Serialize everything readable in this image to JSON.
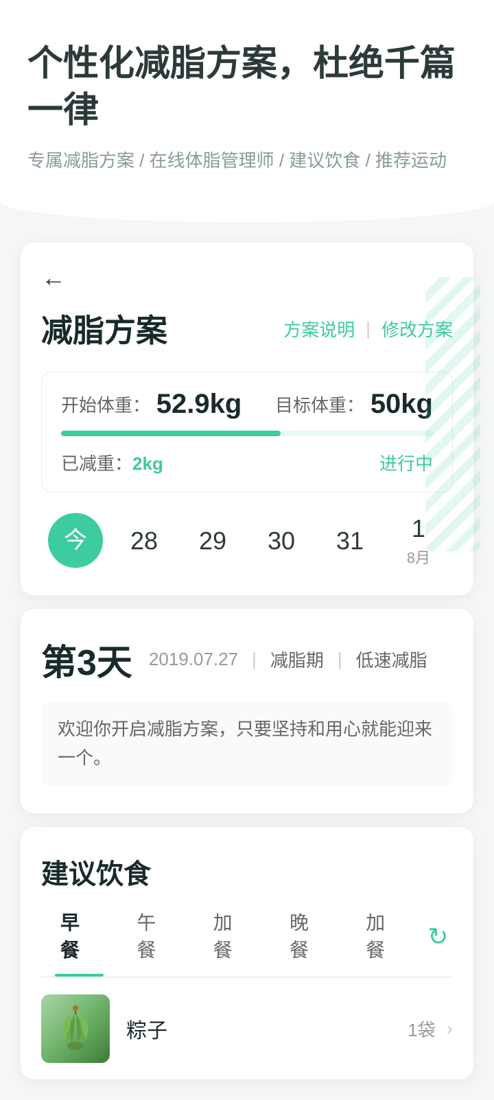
{
  "header": {
    "main_title": "个性化减脂方案，杜绝千篇一律",
    "subtitle": "专属减脂方案 / 在线体脂管理师 / 建议饮食 / 推荐运动"
  },
  "plan_card": {
    "back_label": "←",
    "title": "减脂方案",
    "action_description": "方案说明",
    "action_divider": "|",
    "action_modify": "修改方案",
    "start_label": "开始体重：",
    "start_value": "52.9kg",
    "target_label": "目标体重：",
    "target_value": "50kg",
    "progress_percent": 59,
    "lost_label": "已减重：",
    "lost_value": "2kg",
    "status": "进行中"
  },
  "calendar": {
    "days": [
      {
        "label": "今",
        "sub": "",
        "today": true
      },
      {
        "label": "28",
        "sub": ""
      },
      {
        "label": "29",
        "sub": ""
      },
      {
        "label": "30",
        "sub": ""
      },
      {
        "label": "31",
        "sub": ""
      },
      {
        "label": "1",
        "sub": "8月"
      }
    ]
  },
  "day_info": {
    "day_number": "第3天",
    "date": "2019.07.27",
    "separator1": "|",
    "tag1": "减脂期",
    "separator2": "|",
    "tag2": "低速减脂",
    "welcome_text": "欢迎你开启减脂方案，只要坚持和用心就能迎来一个。"
  },
  "diet_section": {
    "title": "建议饮食",
    "tabs": [
      {
        "label": "早餐",
        "active": true
      },
      {
        "label": "午餐",
        "active": false
      },
      {
        "label": "加餐",
        "active": false
      },
      {
        "label": "晚餐",
        "active": false
      },
      {
        "label": "加餐",
        "active": false
      }
    ],
    "refresh_icon_label": "↻",
    "food_items": [
      {
        "name": "粽子",
        "amount": "1袋",
        "has_arrow": true
      }
    ]
  },
  "colors": {
    "accent": "#3dcba0",
    "text_dark": "#1a2a2a",
    "text_gray": "#666666",
    "text_light": "#999999"
  }
}
